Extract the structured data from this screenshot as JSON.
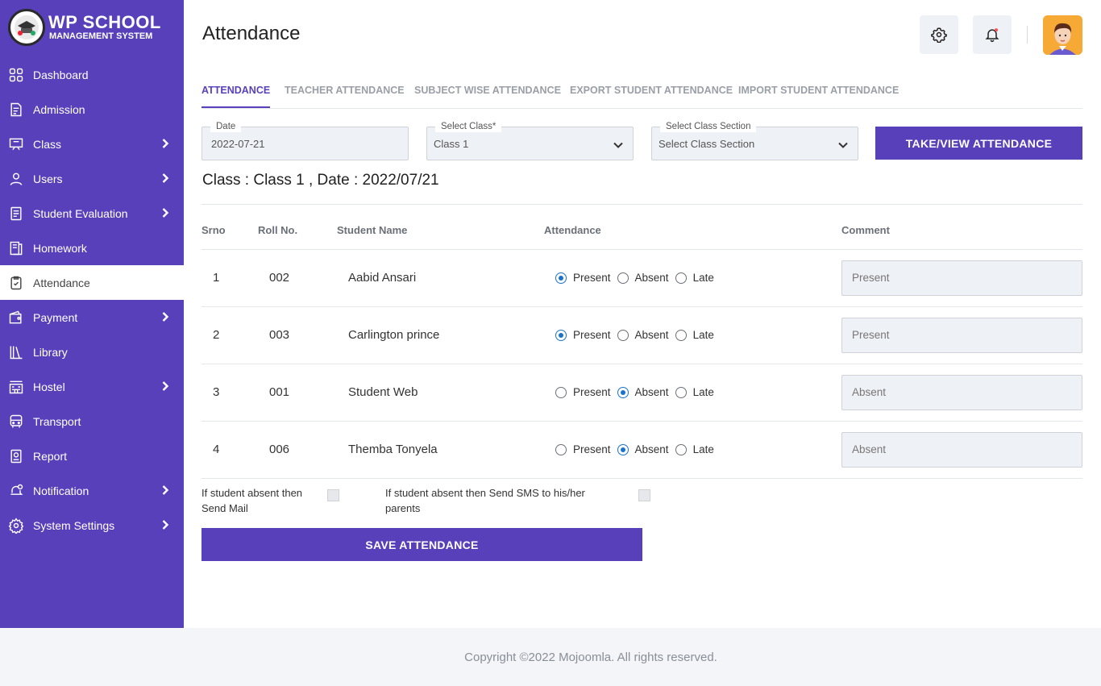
{
  "app": {
    "logo_title": "WP SCHOOL",
    "logo_subtitle": "MANAGEMENT SYSTEM"
  },
  "sidebar": {
    "items": [
      {
        "label": "Dashboard",
        "icon": "dashboard-icon",
        "has_submenu": false,
        "active": false
      },
      {
        "label": "Admission",
        "icon": "admission-icon",
        "has_submenu": false,
        "active": false
      },
      {
        "label": "Class",
        "icon": "class-icon",
        "has_submenu": true,
        "active": false
      },
      {
        "label": "Users",
        "icon": "user-icon",
        "has_submenu": true,
        "active": false
      },
      {
        "label": "Student Evaluation",
        "icon": "evaluation-icon",
        "has_submenu": true,
        "active": false
      },
      {
        "label": "Homework",
        "icon": "homework-icon",
        "has_submenu": false,
        "active": false
      },
      {
        "label": "Attendance",
        "icon": "attendance-icon",
        "has_submenu": false,
        "active": true
      },
      {
        "label": "Payment",
        "icon": "wallet-icon",
        "has_submenu": true,
        "active": false
      },
      {
        "label": "Library",
        "icon": "library-icon",
        "has_submenu": false,
        "active": false
      },
      {
        "label": "Hostel",
        "icon": "hostel-icon",
        "has_submenu": true,
        "active": false
      },
      {
        "label": "Transport",
        "icon": "bus-icon",
        "has_submenu": false,
        "active": false
      },
      {
        "label": "Report",
        "icon": "report-icon",
        "has_submenu": false,
        "active": false
      },
      {
        "label": "Notification",
        "icon": "notification-icon",
        "has_submenu": true,
        "active": false
      },
      {
        "label": "System Settings",
        "icon": "settings-icon",
        "has_submenu": true,
        "active": false
      }
    ]
  },
  "header": {
    "title": "Attendance",
    "settings_icon": "gear-icon",
    "notification_icon": "bell-icon"
  },
  "tabs": [
    {
      "label": "ATTENDANCE",
      "active": true
    },
    {
      "label": "TEACHER ATTENDANCE",
      "active": false
    },
    {
      "label": "SUBJECT WISE ATTENDANCE",
      "active": false
    },
    {
      "label": "EXPORT STUDENT ATTENDANCE",
      "active": false
    },
    {
      "label": "IMPORT STUDENT ATTENDANCE",
      "active": false
    }
  ],
  "filters": {
    "date_label": "Date",
    "date_value": "2022-07-21",
    "class_label": "Select Class*",
    "class_value": "Class 1",
    "section_label": "Select Class Section",
    "section_value": "Select Class Section",
    "submit_label": "TAKE/VIEW  ATTENDANCE"
  },
  "class_info": "Class : Class 1 , Date : 2022/07/21",
  "table": {
    "headers": {
      "srno": "Srno",
      "roll": "Roll No.",
      "name": "Student Name",
      "attendance": "Attendance",
      "comment": "Comment"
    },
    "options": [
      "Present",
      "Absent",
      "Late"
    ],
    "rows": [
      {
        "srno": "1",
        "roll": "002",
        "name": "Aabid Ansari",
        "status": "Present",
        "comment": "Present"
      },
      {
        "srno": "2",
        "roll": "003",
        "name": "Carlington prince",
        "status": "Present",
        "comment": "Present"
      },
      {
        "srno": "3",
        "roll": "001",
        "name": "Student Web",
        "status": "Absent",
        "comment": "Absent"
      },
      {
        "srno": "4",
        "roll": "006",
        "name": "Themba Tonyela",
        "status": "Absent",
        "comment": "Absent"
      }
    ]
  },
  "options": {
    "mail_label_1": "If student absent then",
    "mail_label_2": "Send Mail",
    "sms_label_1": "If student absent then Send SMS to his/her",
    "sms_label_2": "parents",
    "mail_checked": false,
    "sms_checked": false
  },
  "save_label": "SAVE  ATTENDANCE",
  "footer": "Copyright ©2022 Mojoomla. All rights reserved.",
  "colors": {
    "primary": "#5840bb",
    "radio_selected": "#1a73c8",
    "field_bg": "#eef1f5"
  }
}
